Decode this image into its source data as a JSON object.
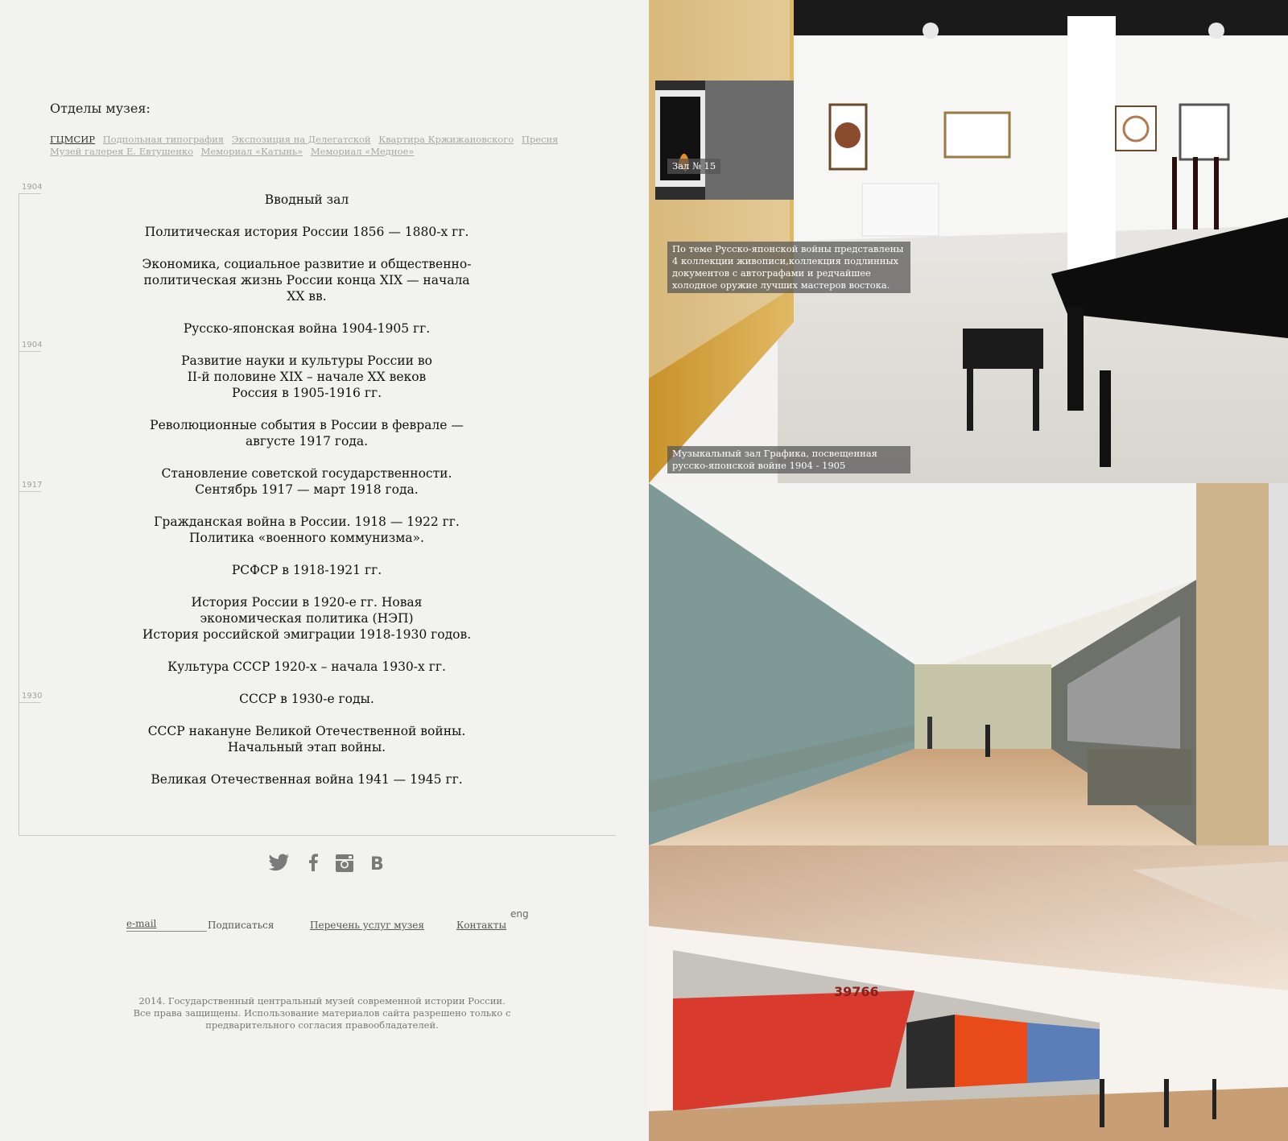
{
  "departments": {
    "title": "Отделы музея:",
    "links": [
      "ГЦМСИР",
      "Подпольная типография",
      "Экспозиция на Делегатской",
      "Квартира Кржижановского",
      "Пресня",
      "Музей галерея Е. Евтушенко",
      "Мемориал «Катынь»",
      "Мемориал «Медное»"
    ]
  },
  "timeline": {
    "ticks": [
      "1904",
      "1904",
      "1917",
      "1930"
    ]
  },
  "halls": [
    "Вводный зал",
    "Политическая история России 1856 — 1880-х гг.",
    "Экономика, социальное развитие и общественно-\nполитическая жизнь России конца XIX — начала\nXX вв.",
    "Русско-японская война 1904-1905 гг.",
    "Развитие науки и культуры России во\nII-й половине XIX –  начале XX веков\nРоссия в 1905-1916 гг.",
    "Революционные события в России в феврале —\nавгусте 1917 года.",
    "Становление советской государственности.\nСентябрь 1917 — март 1918 года.",
    "Гражданская война в России. 1918 — 1922 гг.\nПолитика «военного коммунизма».",
    "РСФСР в 1918-1921 гг.",
    "История России в 1920-е гг. Новая\nэкономическая политика (НЭП)\nИстория российской эмиграции 1918-1930 годов.",
    "Культура СССР 1920-х – начала 1930-х гг.",
    "СССР в 1930-е годы.",
    "СССР накануне Великой Отечественной войны.\nНачальный этап войны.",
    "Великая Отечественная война 1941 — 1945 гг."
  ],
  "social": {
    "twitter": "twitter-icon",
    "facebook": "facebook-icon",
    "instagram": "instagram-icon",
    "vk": "vk-icon"
  },
  "footer": {
    "email_placeholder": "e-mail",
    "subscribe": "Подписаться",
    "services": "Перечень услуг музея",
    "contacts": "Контакты",
    "lang": "eng",
    "copyright": "2014. Государственный центральный музей современной истории России.\nВсе права защищены. Использование материалов сайта разрешено только с\nпредварительного согласия правообладателей."
  },
  "photos": {
    "hall_label": "Зал № 15",
    "caption_top": "По теме Русско-японской войны представлены\n4 коллекции живописи,коллекция подлинных\nдокументов с автографами и редчайшее\nхолодное оружие лучших мастеров востока.",
    "caption_bottom": "Музыкальный зал Графика, посвещенная\nрусско-японской войне 1904 - 1905",
    "mural_number": "39766"
  }
}
